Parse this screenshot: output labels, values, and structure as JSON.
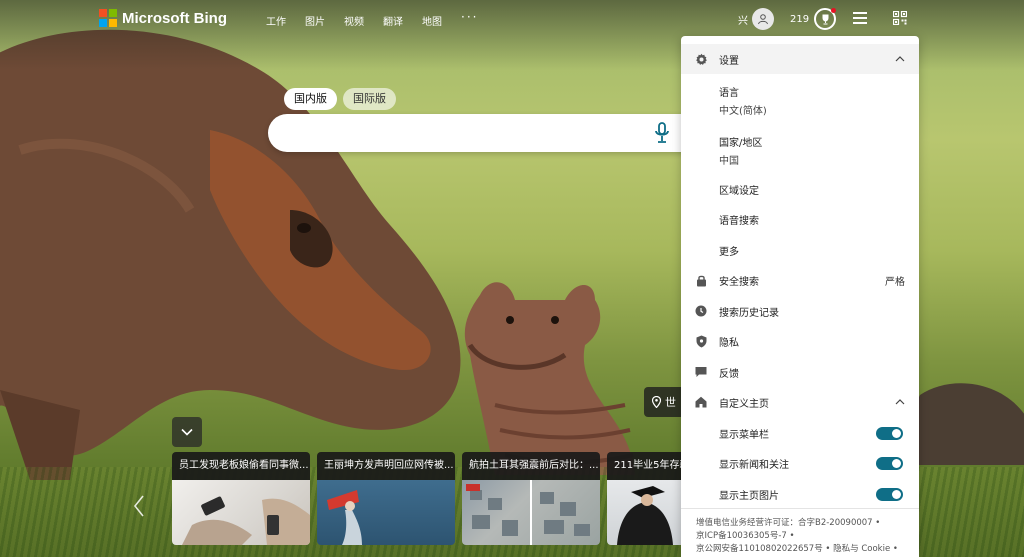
{
  "header": {
    "logo_text": "Microsoft Bing",
    "nav": [
      "工作",
      "图片",
      "视频",
      "翻译",
      "地图"
    ],
    "nav_more": "···",
    "user_name": "兴",
    "reward_points": "219"
  },
  "search": {
    "tabs": [
      "国内版",
      "国际版"
    ],
    "active_tab": "国内版",
    "value": ""
  },
  "location_chip": {
    "text": "世"
  },
  "news": [
    {
      "title": "员工发现老板娘偷看同事微..."
    },
    {
      "title": "王丽坤方发声明回应网传被..."
    },
    {
      "title": "航拍土耳其强震前后对比：..."
    },
    {
      "title": "211毕业5年存款"
    }
  ],
  "settings": {
    "title": "设置",
    "language_label": "语言",
    "language_value": "中文(简体)",
    "region_label": "国家/地区",
    "region_value": "中国",
    "region_settings": "区域设定",
    "voice_search": "语音搜索",
    "more": "更多",
    "safe_search": "安全搜索",
    "safe_search_value": "严格",
    "search_history": "搜索历史记录",
    "privacy": "隐私",
    "feedback": "反馈",
    "customize_home": "自定义主页",
    "show_menu_bar": "显示菜单栏",
    "show_news": "显示新闻和关注",
    "show_home_image": "显示主页图片",
    "toggles": {
      "menu_bar": true,
      "news": true,
      "home_image": true
    }
  },
  "footer": {
    "line1": "增值电信业务经营许可证：合字B2-20090007 •",
    "line2": "京ICP备10036305号-7 •",
    "line3": "京公网安备11010802022657号 • 隐私与 Cookie •"
  },
  "colors": {
    "toggle_on": "#0f6e87",
    "bing_red": "#f25022",
    "bing_green": "#7fba00",
    "bing_blue": "#00a4ef",
    "bing_yellow": "#ffb900"
  }
}
